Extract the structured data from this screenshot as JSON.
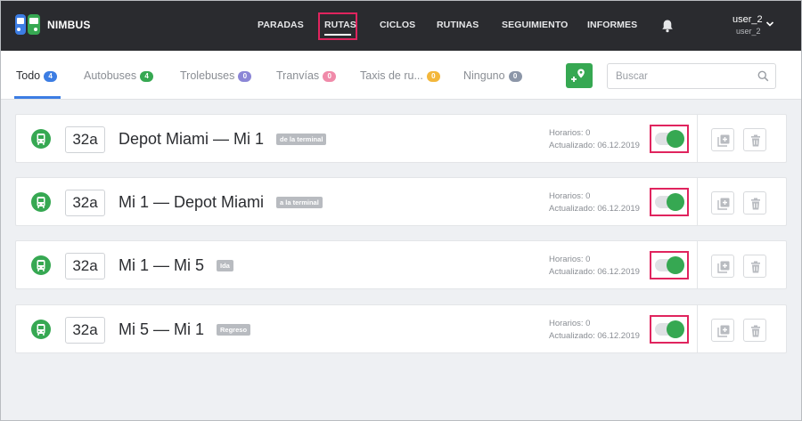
{
  "app": {
    "brand": "NIMBUS"
  },
  "nav": {
    "items": [
      "PARADAS",
      "RUTAS",
      "CICLOS",
      "RUTINAS",
      "SEGUIMIENTO",
      "INFORMES"
    ],
    "active": "RUTAS"
  },
  "user": {
    "name": "user_2",
    "sub": "user_2"
  },
  "filters": [
    {
      "label": "Todo",
      "count": "4",
      "color": "#3c7de3"
    },
    {
      "label": "Autobuses",
      "count": "4",
      "color": "#36a852"
    },
    {
      "label": "Trolebuses",
      "count": "0",
      "color": "#8b86d6"
    },
    {
      "label": "Tranvías",
      "count": "0",
      "color": "#f08aa9"
    },
    {
      "label": "Taxis de ru...",
      "count": "0",
      "color": "#f3b73b"
    },
    {
      "label": "Ninguno",
      "count": "0",
      "color": "#8c96a8"
    }
  ],
  "search": {
    "placeholder": "Buscar"
  },
  "routes": [
    {
      "number": "32a",
      "name": "Depot Miami — Mi 1",
      "tag": "de la terminal",
      "schedules_label": "Horarios: 0",
      "updated_label": "Actualizado: 06.12.2019"
    },
    {
      "number": "32a",
      "name": "Mi 1 — Depot Miami",
      "tag": "a la terminal",
      "schedules_label": "Horarios: 0",
      "updated_label": "Actualizado: 06.12.2019"
    },
    {
      "number": "32a",
      "name": "Mi 1 — Mi 5",
      "tag": "Ida",
      "schedules_label": "Horarios: 0",
      "updated_label": "Actualizado: 06.12.2019"
    },
    {
      "number": "32a",
      "name": "Mi 5 — Mi 1",
      "tag": "Regreso",
      "schedules_label": "Horarios: 0",
      "updated_label": "Actualizado: 06.12.2019"
    }
  ],
  "colors": {
    "accent_green": "#36a852",
    "highlight": "#e0245e",
    "topbar": "#2a2b2f"
  },
  "icons": {
    "logo": "nimbus-logo",
    "bell": "bell-icon",
    "bus": "bus-icon",
    "add_route": "map-pin-add-icon",
    "copy": "copy-add-icon",
    "delete": "trash-icon",
    "search": "search-icon"
  }
}
